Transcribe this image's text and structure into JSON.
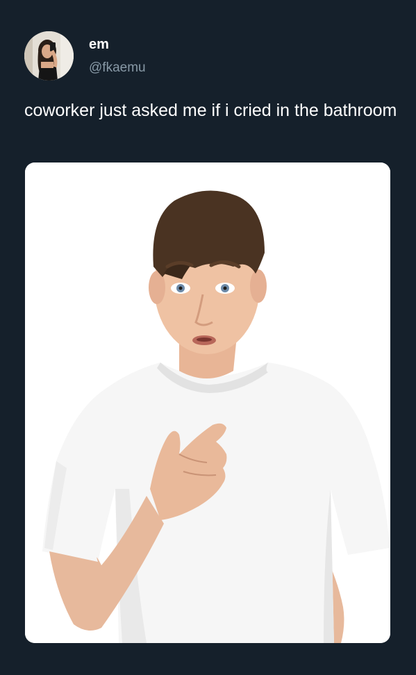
{
  "author": {
    "display_name": "em",
    "handle": "@fkaemu"
  },
  "tweet": {
    "text": "coworker just asked me if i cried in the bathroom"
  },
  "media": {
    "type": "photo"
  },
  "colors": {
    "background": "#15202b",
    "text_primary": "#ffffff",
    "text_secondary": "#8899a6",
    "media_background": "#ffffff"
  }
}
